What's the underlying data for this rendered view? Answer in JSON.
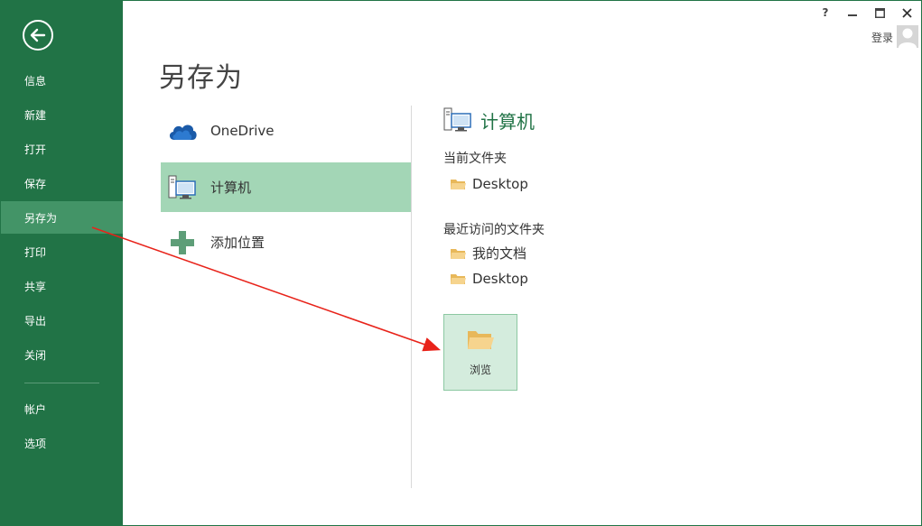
{
  "colors": {
    "brand_green": "#217346",
    "sidebar_active": "#439467",
    "selected_place": "#a3d6b6",
    "browse_bg": "#d4ecdd",
    "annotation_arrow": "#e8231a"
  },
  "titlebar": {
    "help": "?",
    "minimize": "—",
    "maximize": "□",
    "close": "✕",
    "login": "登录"
  },
  "sidebar": {
    "back_icon": "back-arrow-icon",
    "items": [
      {
        "label": "信息"
      },
      {
        "label": "新建"
      },
      {
        "label": "打开"
      },
      {
        "label": "保存"
      },
      {
        "label": "另存为"
      },
      {
        "label": "打印"
      },
      {
        "label": "共享"
      },
      {
        "label": "导出"
      },
      {
        "label": "关闭"
      },
      {
        "label": "帐户"
      },
      {
        "label": "选项"
      }
    ]
  },
  "main": {
    "title": "另存为",
    "places": [
      {
        "label": "OneDrive",
        "icon": "cloud-icon"
      },
      {
        "label": "计算机",
        "icon": "computer-icon"
      },
      {
        "label": "添加位置",
        "icon": "plus-icon"
      }
    ]
  },
  "right_panel": {
    "header": "计算机",
    "current_folder_label": "当前文件夹",
    "current_folders": [
      "Desktop"
    ],
    "recent_label": "最近访问的文件夹",
    "recent_folders": [
      "我的文档",
      "Desktop"
    ],
    "browse_label": "浏览"
  }
}
